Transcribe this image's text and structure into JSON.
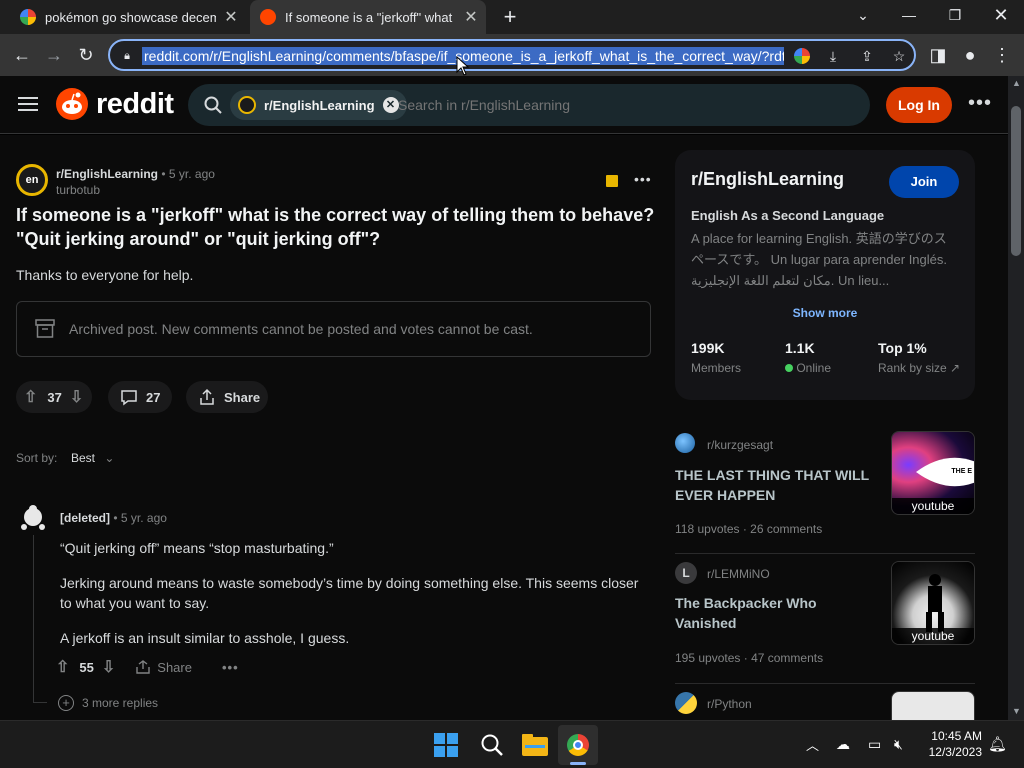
{
  "browser": {
    "tabs": [
      {
        "title": "pokémon go showcase december",
        "active": false
      },
      {
        "title": "If someone is a \"jerkoff\" what is the",
        "active": true
      }
    ],
    "url": "reddit.com/r/EnglishLearning/comments/bfaspe/if_someone_is_a_jerkoff_what_is_the_correct_way/?rdt=..."
  },
  "header": {
    "logo_text": "reddit",
    "search_chip": "r/EnglishLearning",
    "search_placeholder": "Search in r/EnglishLearning",
    "login_label": "Log In"
  },
  "post": {
    "subreddit": "r/EnglishLearning",
    "age": "• 5 yr. ago",
    "author": "turbotub",
    "title": "If someone is a \"jerkoff\" what is the correct way of telling them to behave? \"Quit jerking around\" or \"quit jerking off\"?",
    "body": "Thanks to everyone for help.",
    "archived_notice": "Archived post. New comments cannot be posted and votes cannot be cast.",
    "votes": "37",
    "comments": "27",
    "share_label": "Share"
  },
  "sort": {
    "label": "Sort by:",
    "value": "Best"
  },
  "comment": {
    "author": "[deleted]",
    "age": "• 5 yr. ago",
    "paragraphs": [
      "“Quit jerking off” means “stop masturbating.”",
      "Jerking around means to waste somebody’s time by doing something else. This seems closer to what you want to say.",
      "A jerkoff is an insult similar to asshole, I guess."
    ],
    "votes": "55",
    "share_label": "Share",
    "more_replies": "3 more replies"
  },
  "sidebar": {
    "name": "r/EnglishLearning",
    "join_label": "Join",
    "subtitle": "English As a Second Language",
    "description": "A place for learning English. 英語の学びのスペースです。 Un lugar para aprender Inglés. مكان لتعلم اللغة الإنجليزية. Un lieu...",
    "show_more": "Show more",
    "stats": [
      {
        "value": "199K",
        "label": "Members"
      },
      {
        "value": "1.1K",
        "label": "Online"
      },
      {
        "value": "Top 1%",
        "label": "Rank by size"
      }
    ]
  },
  "feed": [
    {
      "sub": "r/kurzgesagt",
      "title": "THE LAST THING THAT WILL EVER HAPPEN",
      "upvotes": "118 upvotes",
      "comments": "26 comments",
      "thumb_label": "youtube",
      "thumb_text": "THE E"
    },
    {
      "sub": "r/LEMMiNO",
      "title": "The Backpacker Who Vanished",
      "upvotes": "195 upvotes",
      "comments": "47 comments",
      "thumb_label": "youtube"
    },
    {
      "sub": "r/Python"
    }
  ],
  "taskbar": {
    "time": "10:45 AM",
    "date": "12/3/2023"
  },
  "colors": {
    "accent_orange": "#d93a00",
    "join_blue": "#0045ac",
    "omnibox_focus": "#8ab4f8",
    "online_green": "#46d160"
  }
}
